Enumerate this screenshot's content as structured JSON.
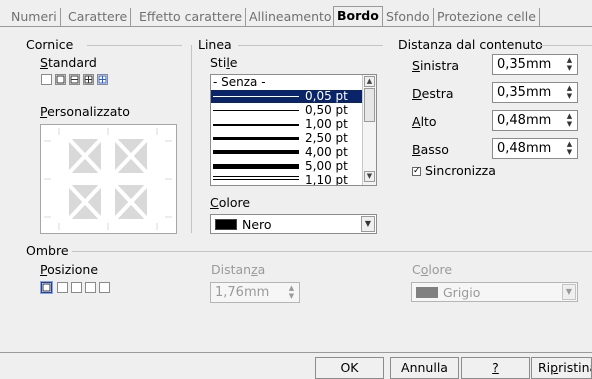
{
  "tabs": [
    "Numeri",
    "Carattere",
    "Effetto carattere",
    "Allineamento",
    "Bordo",
    "Sfondo",
    "Protezione celle"
  ],
  "active_tab": "Bordo",
  "cornice": {
    "title": "Cornice",
    "standard_label": "Standard",
    "standard_presets": [
      "none-icon",
      "box-icon",
      "box-inner-h-icon",
      "box-grid-icon",
      "grid-icon"
    ],
    "custom_label": "Personalizzato"
  },
  "linea": {
    "title": "Linea",
    "stile_label": "Stile",
    "styles": [
      "- Senza -",
      "0,05 pt",
      "0,50 pt",
      "1,00 pt",
      "2,50 pt",
      "4,00 pt",
      "5,00 pt",
      "1,10 pt"
    ],
    "selected_style": "0,05 pt",
    "colore_label": "Colore",
    "colore_value": "Nero",
    "colore_swatch": "#000000"
  },
  "distanza": {
    "title": "Distanza dal contenuto",
    "sinistra_label": "Sinistra",
    "sinistra_value": "0,35mm",
    "destra_label": "Destra",
    "destra_value": "0,35mm",
    "alto_label": "Alto",
    "alto_value": "0,48mm",
    "basso_label": "Basso",
    "basso_value": "0,48mm",
    "sincronizza_label": "Sincronizza",
    "sincronizza_checked": true
  },
  "ombre": {
    "title": "Ombre",
    "posizione_label": "Posizione",
    "distanza_label": "Distanza",
    "distanza_value": "1,76mm",
    "colore_label": "Colore",
    "colore_value": "Grigio",
    "colore_swatch": "#808080"
  },
  "buttons": {
    "ok": "OK",
    "annulla": "Annulla",
    "help": "?",
    "ripristina": "Ripristina"
  },
  "colors": {
    "selection": "#0a246a",
    "disabled": "#9a9a9a"
  }
}
